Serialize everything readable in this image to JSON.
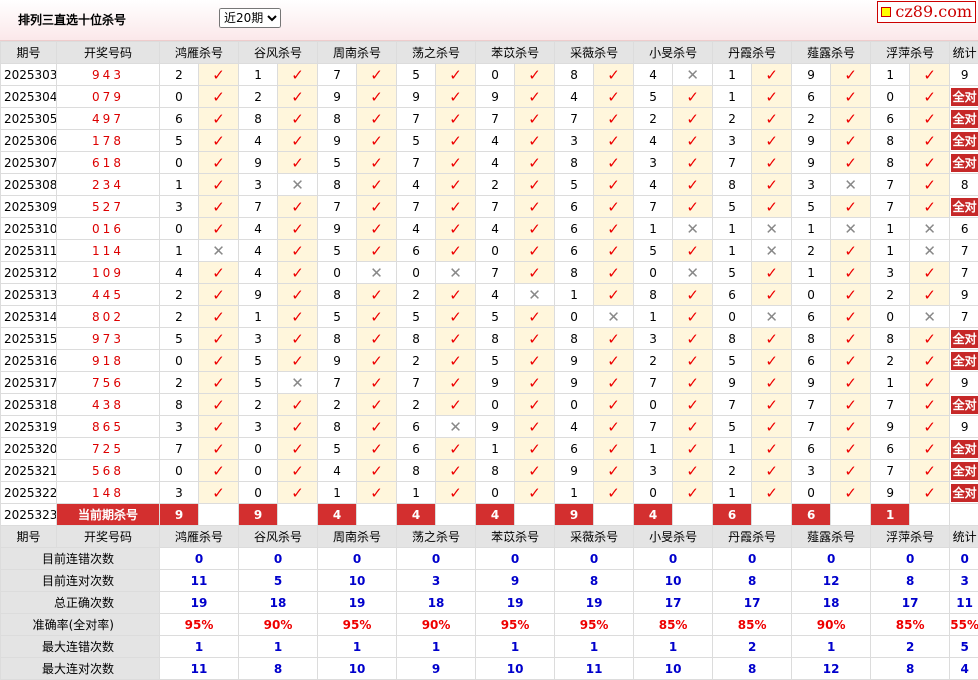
{
  "header": {
    "title": "排列三直选十位杀号",
    "period_selected": "近20期",
    "logo": "cz89.com"
  },
  "columns": {
    "issue": "期号",
    "number": "开奖号码",
    "stat": "统计",
    "experts": [
      "鸿雁杀号",
      "谷风杀号",
      "周南杀号",
      "荡之杀号",
      "苯苡杀号",
      "采薇杀号",
      "小旻杀号",
      "丹霞杀号",
      "薤露杀号",
      "浮萍杀号"
    ]
  },
  "rows": [
    {
      "issue": "2025303",
      "num": "943",
      "kills": [
        2,
        1,
        7,
        5,
        0,
        8,
        4,
        1,
        9,
        1
      ],
      "hits": [
        1,
        1,
        1,
        1,
        1,
        1,
        0,
        1,
        1,
        1
      ],
      "stat": "9"
    },
    {
      "issue": "2025304",
      "num": "079",
      "kills": [
        0,
        2,
        9,
        9,
        9,
        4,
        5,
        1,
        6,
        0
      ],
      "hits": [
        1,
        1,
        1,
        1,
        1,
        1,
        1,
        1,
        1,
        1
      ],
      "stat": "全对"
    },
    {
      "issue": "2025305",
      "num": "497",
      "kills": [
        6,
        8,
        8,
        7,
        7,
        7,
        2,
        2,
        2,
        6
      ],
      "hits": [
        1,
        1,
        1,
        1,
        1,
        1,
        1,
        1,
        1,
        1
      ],
      "stat": "全对"
    },
    {
      "issue": "2025306",
      "num": "178",
      "kills": [
        5,
        4,
        9,
        5,
        4,
        3,
        4,
        3,
        9,
        8
      ],
      "hits": [
        1,
        1,
        1,
        1,
        1,
        1,
        1,
        1,
        1,
        1
      ],
      "stat": "全对"
    },
    {
      "issue": "2025307",
      "num": "618",
      "kills": [
        0,
        9,
        5,
        7,
        4,
        8,
        3,
        7,
        9,
        8
      ],
      "hits": [
        1,
        1,
        1,
        1,
        1,
        1,
        1,
        1,
        1,
        1
      ],
      "stat": "全对"
    },
    {
      "issue": "2025308",
      "num": "234",
      "kills": [
        1,
        3,
        8,
        4,
        2,
        5,
        4,
        8,
        3,
        7
      ],
      "hits": [
        1,
        0,
        1,
        1,
        1,
        1,
        1,
        1,
        0,
        1
      ],
      "stat": "8"
    },
    {
      "issue": "2025309",
      "num": "527",
      "kills": [
        3,
        7,
        7,
        7,
        7,
        6,
        7,
        5,
        5,
        7
      ],
      "hits": [
        1,
        1,
        1,
        1,
        1,
        1,
        1,
        1,
        1,
        1
      ],
      "stat": "全对"
    },
    {
      "issue": "2025310",
      "num": "016",
      "kills": [
        0,
        4,
        9,
        4,
        4,
        6,
        1,
        1,
        1,
        1
      ],
      "hits": [
        1,
        1,
        1,
        1,
        1,
        1,
        0,
        0,
        0,
        0
      ],
      "stat": "6"
    },
    {
      "issue": "2025311",
      "num": "114",
      "kills": [
        1,
        4,
        5,
        6,
        0,
        6,
        5,
        1,
        2,
        1
      ],
      "hits": [
        0,
        1,
        1,
        1,
        1,
        1,
        1,
        0,
        1,
        0
      ],
      "stat": "7"
    },
    {
      "issue": "2025312",
      "num": "109",
      "kills": [
        4,
        4,
        0,
        0,
        7,
        8,
        0,
        5,
        1,
        3
      ],
      "hits": [
        1,
        1,
        0,
        0,
        1,
        1,
        0,
        1,
        1,
        1
      ],
      "stat": "7"
    },
    {
      "issue": "2025313",
      "num": "445",
      "kills": [
        2,
        9,
        8,
        2,
        4,
        1,
        8,
        6,
        0,
        2
      ],
      "hits": [
        1,
        1,
        1,
        1,
        0,
        1,
        1,
        1,
        1,
        1
      ],
      "stat": "9"
    },
    {
      "issue": "2025314",
      "num": "802",
      "kills": [
        2,
        1,
        5,
        5,
        5,
        0,
        1,
        0,
        6,
        0
      ],
      "hits": [
        1,
        1,
        1,
        1,
        1,
        0,
        1,
        0,
        1,
        0
      ],
      "stat": "7"
    },
    {
      "issue": "2025315",
      "num": "973",
      "kills": [
        5,
        3,
        8,
        8,
        8,
        8,
        3,
        8,
        8,
        8
      ],
      "hits": [
        1,
        1,
        1,
        1,
        1,
        1,
        1,
        1,
        1,
        1
      ],
      "stat": "全对"
    },
    {
      "issue": "2025316",
      "num": "918",
      "kills": [
        0,
        5,
        9,
        2,
        5,
        9,
        2,
        5,
        6,
        2
      ],
      "hits": [
        1,
        1,
        1,
        1,
        1,
        1,
        1,
        1,
        1,
        1
      ],
      "stat": "全对"
    },
    {
      "issue": "2025317",
      "num": "756",
      "kills": [
        2,
        5,
        7,
        7,
        9,
        9,
        7,
        9,
        9,
        1
      ],
      "hits": [
        1,
        0,
        1,
        1,
        1,
        1,
        1,
        1,
        1,
        1
      ],
      "stat": "9"
    },
    {
      "issue": "2025318",
      "num": "438",
      "kills": [
        8,
        2,
        2,
        2,
        0,
        0,
        0,
        7,
        7,
        7
      ],
      "hits": [
        1,
        1,
        1,
        1,
        1,
        1,
        1,
        1,
        1,
        1
      ],
      "stat": "全对"
    },
    {
      "issue": "2025319",
      "num": "865",
      "kills": [
        3,
        3,
        8,
        6,
        9,
        4,
        7,
        5,
        7,
        9
      ],
      "hits": [
        1,
        1,
        1,
        0,
        1,
        1,
        1,
        1,
        1,
        1
      ],
      "stat": "9"
    },
    {
      "issue": "2025320",
      "num": "725",
      "kills": [
        7,
        0,
        5,
        6,
        1,
        6,
        1,
        1,
        6,
        6
      ],
      "hits": [
        1,
        1,
        1,
        1,
        1,
        1,
        1,
        1,
        1,
        1
      ],
      "stat": "全对"
    },
    {
      "issue": "2025321",
      "num": "568",
      "kills": [
        0,
        0,
        4,
        8,
        8,
        9,
        3,
        2,
        3,
        7
      ],
      "hits": [
        1,
        1,
        1,
        1,
        1,
        1,
        1,
        1,
        1,
        1
      ],
      "stat": "全对"
    },
    {
      "issue": "2025322",
      "num": "148",
      "kills": [
        3,
        0,
        1,
        1,
        0,
        1,
        0,
        1,
        0,
        9
      ],
      "hits": [
        1,
        1,
        1,
        1,
        1,
        1,
        1,
        1,
        1,
        1
      ],
      "stat": "全对"
    }
  ],
  "current": {
    "issue": "2025323",
    "label": "当前期杀号",
    "kills": [
      "9",
      "9",
      "4",
      "4",
      "4",
      "9",
      "4",
      "6",
      "6",
      "1"
    ]
  },
  "marks": {
    "ok": "✓",
    "bad": "✕"
  },
  "stats": [
    {
      "label": "目前连错次数",
      "vals": [
        "0",
        "0",
        "0",
        "0",
        "0",
        "0",
        "0",
        "0",
        "0",
        "0"
      ],
      "total": "0",
      "color": "blue"
    },
    {
      "label": "目前连对次数",
      "vals": [
        "11",
        "5",
        "10",
        "3",
        "9",
        "8",
        "10",
        "8",
        "12",
        "8"
      ],
      "total": "3",
      "color": "blue"
    },
    {
      "label": "总正确次数",
      "vals": [
        "19",
        "18",
        "19",
        "18",
        "19",
        "19",
        "17",
        "17",
        "18",
        "17"
      ],
      "total": "11",
      "color": "blue"
    },
    {
      "label": "准确率(全对率)",
      "vals": [
        "95%",
        "90%",
        "95%",
        "90%",
        "95%",
        "95%",
        "85%",
        "85%",
        "90%",
        "85%"
      ],
      "total": "55%",
      "color": "red"
    },
    {
      "label": "最大连错次数",
      "vals": [
        "1",
        "1",
        "1",
        "1",
        "1",
        "1",
        "1",
        "2",
        "1",
        "2"
      ],
      "total": "5",
      "color": "blue"
    },
    {
      "label": "最大连对次数",
      "vals": [
        "11",
        "8",
        "10",
        "9",
        "10",
        "11",
        "10",
        "8",
        "12",
        "8"
      ],
      "total": "4",
      "color": "blue"
    }
  ],
  "colors": {
    "accent": "#d32f2f",
    "check": "#ee0000",
    "cross": "#888888",
    "hit_bg": "#fff6dc",
    "header_bg": "#e4e4e4",
    "stat_blue": "#0000cc"
  }
}
